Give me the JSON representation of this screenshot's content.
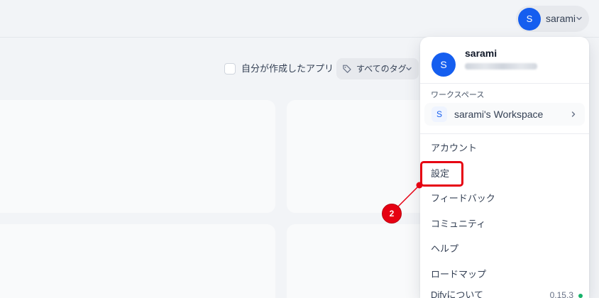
{
  "header": {
    "user_menu": {
      "avatar_initial": "S",
      "username": "sarami",
      "chevron_icon": "chevron-down-icon"
    }
  },
  "filters": {
    "my_apps": {
      "label": "自分が作成したアプリ",
      "checked": false
    },
    "tag_filter": {
      "label": "すべてのタグ",
      "icon": "tag-icon",
      "chevron_icon": "chevron-down-icon"
    }
  },
  "account_menu": {
    "profile": {
      "avatar_initial": "S",
      "username": "sarami"
    },
    "workspace_section_label": "ワークスペース",
    "current_workspace": {
      "badge_initial": "S",
      "name": "sarami's Workspace",
      "chevron_icon": "chevron-right-icon"
    },
    "items": [
      {
        "label": "アカウント"
      },
      {
        "label": "設定"
      },
      {
        "label": "フィードバック"
      },
      {
        "label": "コミュニティ"
      },
      {
        "label": "ヘルプ"
      },
      {
        "label": "ロードマップ"
      },
      {
        "label": "Difyについて",
        "version": "0.15.3",
        "status_color": "#17b26a"
      }
    ]
  },
  "annotation": {
    "step_number": "2",
    "color": "#e60012"
  },
  "colors": {
    "accent": "#155eef",
    "background": "#f2f4f7",
    "card": "#f9fafb",
    "menu": "#ffffff"
  }
}
